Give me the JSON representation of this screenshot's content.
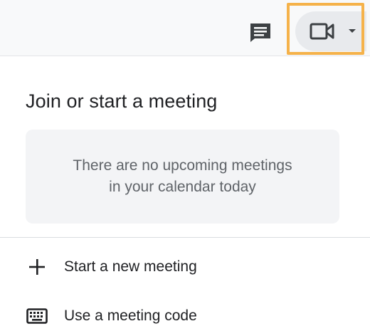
{
  "toolbar": {
    "chat_icon": "chat-icon",
    "meet_button": {
      "camera_icon": "video-camera-icon",
      "caret_icon": "caret-down-icon"
    },
    "highlight_color": "#f5b24a"
  },
  "panel": {
    "title": "Join or start a meeting",
    "empty_state": {
      "line1": "There are no upcoming meetings",
      "line2": "in your calendar today"
    },
    "actions": [
      {
        "label": "Start a new meeting",
        "icon": "plus-icon"
      },
      {
        "label": "Use a meeting code",
        "icon": "keyboard-icon"
      }
    ]
  },
  "colors": {
    "text_primary": "#202124",
    "text_secondary": "#5f6368",
    "card_bg": "#f3f4f6",
    "toolbar_bg": "#f8f9fa"
  }
}
